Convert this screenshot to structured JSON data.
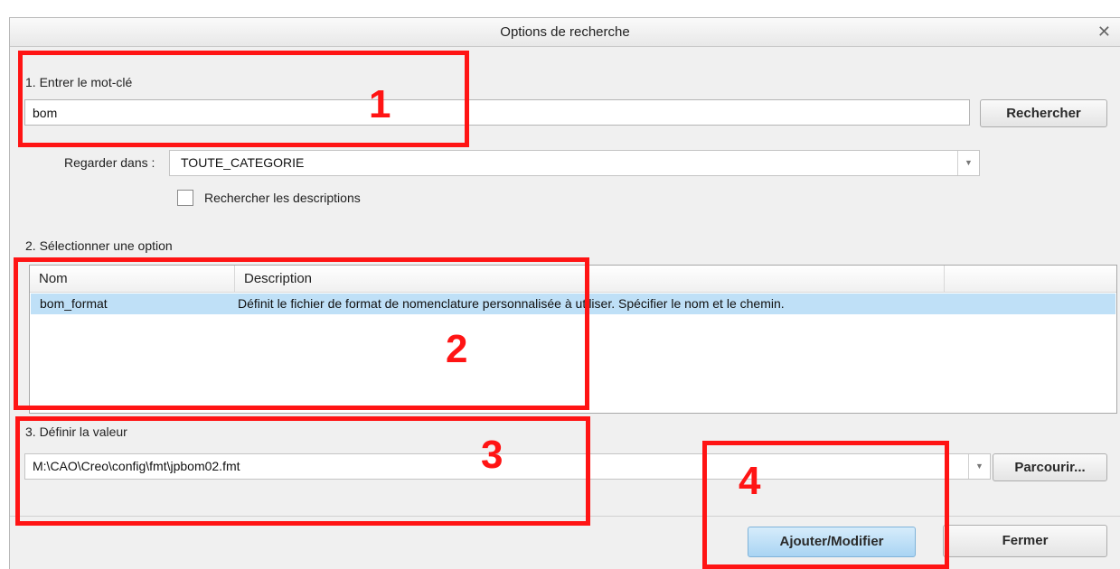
{
  "dialog": {
    "title": "Options de recherche",
    "close_icon": "close-icon"
  },
  "step1": {
    "label": "1.  Entrer le mot-clé",
    "keyword_value": "bom",
    "search_button": "Rechercher",
    "look_in_label": "Regarder dans :",
    "look_in_value": "TOUTE_CATEGORIE",
    "search_descriptions_label": "Rechercher les descriptions",
    "search_descriptions_checked": false
  },
  "step2": {
    "label": "2.  Sélectionner une option",
    "columns": [
      "Nom",
      "Description"
    ],
    "rows": [
      {
        "name": "bom_format",
        "description": "Définit le fichier de format de nomenclature personnalisée à utiliser.  Spécifier le nom et le chemin.",
        "selected": true
      }
    ]
  },
  "step3": {
    "label": "3.  Définir la valeur",
    "value": "M:\\CAO\\Creo\\config\\fmt\\jpbom02.fmt",
    "browse_button": "Parcourir..."
  },
  "footer": {
    "add_modify_button": "Ajouter/Modifier",
    "close_button": "Fermer"
  },
  "annotations": {
    "color": "#ff1414",
    "markers": [
      "1",
      "2",
      "3",
      "4"
    ]
  },
  "colors": {
    "selected_row": "#bfe0f7",
    "primary_button": "#a9d4f3"
  }
}
